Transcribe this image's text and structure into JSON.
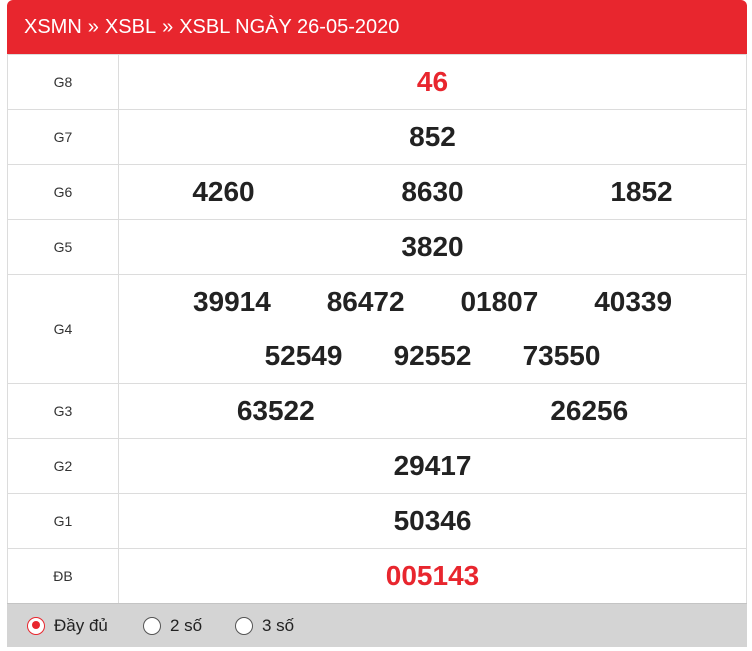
{
  "header": {
    "crumb_1": "XSMN",
    "sep_1": "»",
    "crumb_2": "XSBL",
    "sep_2": "»",
    "crumb_3": "XSBL NGÀY 26-05-2020"
  },
  "prizes": [
    {
      "label": "G8",
      "numbers": [
        "46"
      ]
    },
    {
      "label": "G7",
      "numbers": [
        "852"
      ]
    },
    {
      "label": "G6",
      "numbers": [
        "4260",
        "8630",
        "1852"
      ]
    },
    {
      "label": "G5",
      "numbers": [
        "3820"
      ]
    },
    {
      "label": "G4",
      "numbers": [
        "39914",
        "86472",
        "01807",
        "40339",
        "52549",
        "92552",
        "73550"
      ]
    },
    {
      "label": "G3",
      "numbers": [
        "63522",
        "26256"
      ]
    },
    {
      "label": "G2",
      "numbers": [
        "29417"
      ]
    },
    {
      "label": "G1",
      "numbers": [
        "50346"
      ]
    },
    {
      "label": "ĐB",
      "numbers": [
        "005143"
      ]
    }
  ],
  "display_options": [
    {
      "label": "Đầy đủ",
      "selected": true
    },
    {
      "label": "2 số",
      "selected": false
    },
    {
      "label": "3 số",
      "selected": false
    }
  ],
  "colors": {
    "accent": "#e8262e",
    "number": "#222222",
    "footer_bg": "#d4d4d4"
  }
}
